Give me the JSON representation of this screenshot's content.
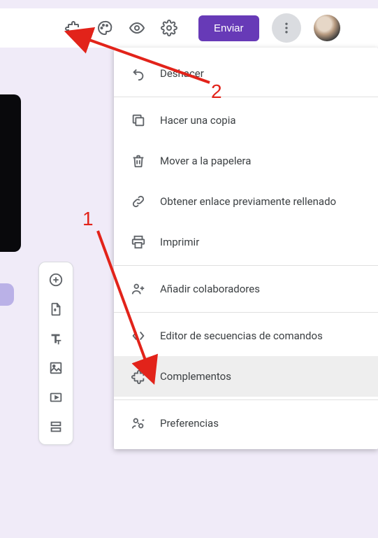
{
  "toolbar": {
    "send_label": "Enviar"
  },
  "menu": {
    "undo": "Deshacer",
    "copy": "Hacer una copia",
    "trash": "Mover a la papelera",
    "link": "Obtener enlace previamente rellenado",
    "print": "Imprimir",
    "collab": "Añadir colaboradores",
    "script": "Editor de secuencias de comandos",
    "addons": "Complementos",
    "prefs": "Preferencias"
  },
  "annotations": {
    "one": "1",
    "two": "2"
  }
}
